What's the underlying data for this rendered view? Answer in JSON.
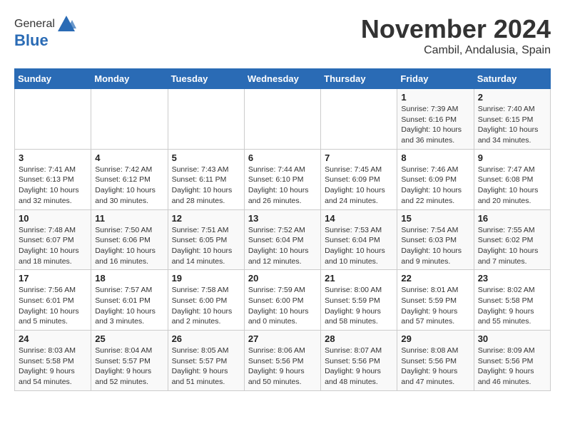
{
  "logo": {
    "general": "General",
    "blue": "Blue"
  },
  "header": {
    "month": "November 2024",
    "location": "Cambil, Andalusia, Spain"
  },
  "days_of_week": [
    "Sunday",
    "Monday",
    "Tuesday",
    "Wednesday",
    "Thursday",
    "Friday",
    "Saturday"
  ],
  "weeks": [
    [
      {
        "day": "",
        "info": ""
      },
      {
        "day": "",
        "info": ""
      },
      {
        "day": "",
        "info": ""
      },
      {
        "day": "",
        "info": ""
      },
      {
        "day": "",
        "info": ""
      },
      {
        "day": "1",
        "info": "Sunrise: 7:39 AM\nSunset: 6:16 PM\nDaylight: 10 hours and 36 minutes."
      },
      {
        "day": "2",
        "info": "Sunrise: 7:40 AM\nSunset: 6:15 PM\nDaylight: 10 hours and 34 minutes."
      }
    ],
    [
      {
        "day": "3",
        "info": "Sunrise: 7:41 AM\nSunset: 6:13 PM\nDaylight: 10 hours and 32 minutes."
      },
      {
        "day": "4",
        "info": "Sunrise: 7:42 AM\nSunset: 6:12 PM\nDaylight: 10 hours and 30 minutes."
      },
      {
        "day": "5",
        "info": "Sunrise: 7:43 AM\nSunset: 6:11 PM\nDaylight: 10 hours and 28 minutes."
      },
      {
        "day": "6",
        "info": "Sunrise: 7:44 AM\nSunset: 6:10 PM\nDaylight: 10 hours and 26 minutes."
      },
      {
        "day": "7",
        "info": "Sunrise: 7:45 AM\nSunset: 6:09 PM\nDaylight: 10 hours and 24 minutes."
      },
      {
        "day": "8",
        "info": "Sunrise: 7:46 AM\nSunset: 6:09 PM\nDaylight: 10 hours and 22 minutes."
      },
      {
        "day": "9",
        "info": "Sunrise: 7:47 AM\nSunset: 6:08 PM\nDaylight: 10 hours and 20 minutes."
      }
    ],
    [
      {
        "day": "10",
        "info": "Sunrise: 7:48 AM\nSunset: 6:07 PM\nDaylight: 10 hours and 18 minutes."
      },
      {
        "day": "11",
        "info": "Sunrise: 7:50 AM\nSunset: 6:06 PM\nDaylight: 10 hours and 16 minutes."
      },
      {
        "day": "12",
        "info": "Sunrise: 7:51 AM\nSunset: 6:05 PM\nDaylight: 10 hours and 14 minutes."
      },
      {
        "day": "13",
        "info": "Sunrise: 7:52 AM\nSunset: 6:04 PM\nDaylight: 10 hours and 12 minutes."
      },
      {
        "day": "14",
        "info": "Sunrise: 7:53 AM\nSunset: 6:04 PM\nDaylight: 10 hours and 10 minutes."
      },
      {
        "day": "15",
        "info": "Sunrise: 7:54 AM\nSunset: 6:03 PM\nDaylight: 10 hours and 9 minutes."
      },
      {
        "day": "16",
        "info": "Sunrise: 7:55 AM\nSunset: 6:02 PM\nDaylight: 10 hours and 7 minutes."
      }
    ],
    [
      {
        "day": "17",
        "info": "Sunrise: 7:56 AM\nSunset: 6:01 PM\nDaylight: 10 hours and 5 minutes."
      },
      {
        "day": "18",
        "info": "Sunrise: 7:57 AM\nSunset: 6:01 PM\nDaylight: 10 hours and 3 minutes."
      },
      {
        "day": "19",
        "info": "Sunrise: 7:58 AM\nSunset: 6:00 PM\nDaylight: 10 hours and 2 minutes."
      },
      {
        "day": "20",
        "info": "Sunrise: 7:59 AM\nSunset: 6:00 PM\nDaylight: 10 hours and 0 minutes."
      },
      {
        "day": "21",
        "info": "Sunrise: 8:00 AM\nSunset: 5:59 PM\nDaylight: 9 hours and 58 minutes."
      },
      {
        "day": "22",
        "info": "Sunrise: 8:01 AM\nSunset: 5:59 PM\nDaylight: 9 hours and 57 minutes."
      },
      {
        "day": "23",
        "info": "Sunrise: 8:02 AM\nSunset: 5:58 PM\nDaylight: 9 hours and 55 minutes."
      }
    ],
    [
      {
        "day": "24",
        "info": "Sunrise: 8:03 AM\nSunset: 5:58 PM\nDaylight: 9 hours and 54 minutes."
      },
      {
        "day": "25",
        "info": "Sunrise: 8:04 AM\nSunset: 5:57 PM\nDaylight: 9 hours and 52 minutes."
      },
      {
        "day": "26",
        "info": "Sunrise: 8:05 AM\nSunset: 5:57 PM\nDaylight: 9 hours and 51 minutes."
      },
      {
        "day": "27",
        "info": "Sunrise: 8:06 AM\nSunset: 5:56 PM\nDaylight: 9 hours and 50 minutes."
      },
      {
        "day": "28",
        "info": "Sunrise: 8:07 AM\nSunset: 5:56 PM\nDaylight: 9 hours and 48 minutes."
      },
      {
        "day": "29",
        "info": "Sunrise: 8:08 AM\nSunset: 5:56 PM\nDaylight: 9 hours and 47 minutes."
      },
      {
        "day": "30",
        "info": "Sunrise: 8:09 AM\nSunset: 5:56 PM\nDaylight: 9 hours and 46 minutes."
      }
    ]
  ]
}
